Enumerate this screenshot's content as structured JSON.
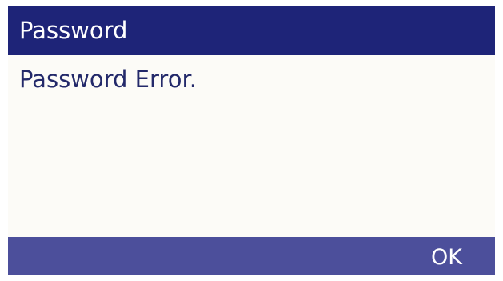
{
  "dialog": {
    "title": "Password",
    "message": "Password Error."
  },
  "softkeys": {
    "ok_label": "OK"
  },
  "colors": {
    "title_bar": "#1e2478",
    "softkey_bar": "#4c4f9b",
    "content_background": "#fcfbf7",
    "message_text": "#23296a",
    "header_text": "#ffffff"
  }
}
